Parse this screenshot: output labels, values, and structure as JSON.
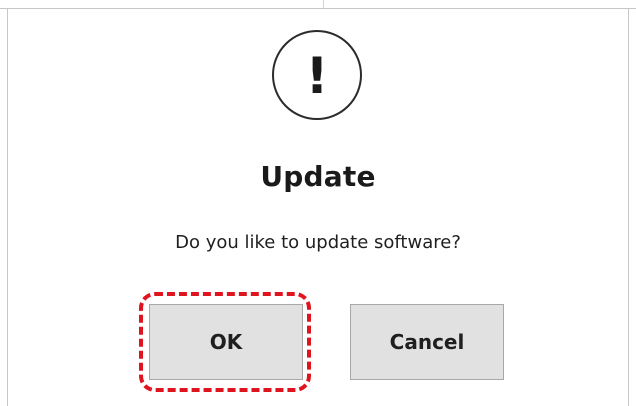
{
  "dialog": {
    "icon": "exclamation-icon",
    "icon_glyph": "!",
    "title": "Update",
    "message": "Do you like to update software?",
    "buttons": [
      {
        "label": "OK"
      },
      {
        "label": "Cancel"
      }
    ]
  },
  "annotation": {
    "highlight_color": "#e0141e",
    "highlight_target": "OK"
  }
}
